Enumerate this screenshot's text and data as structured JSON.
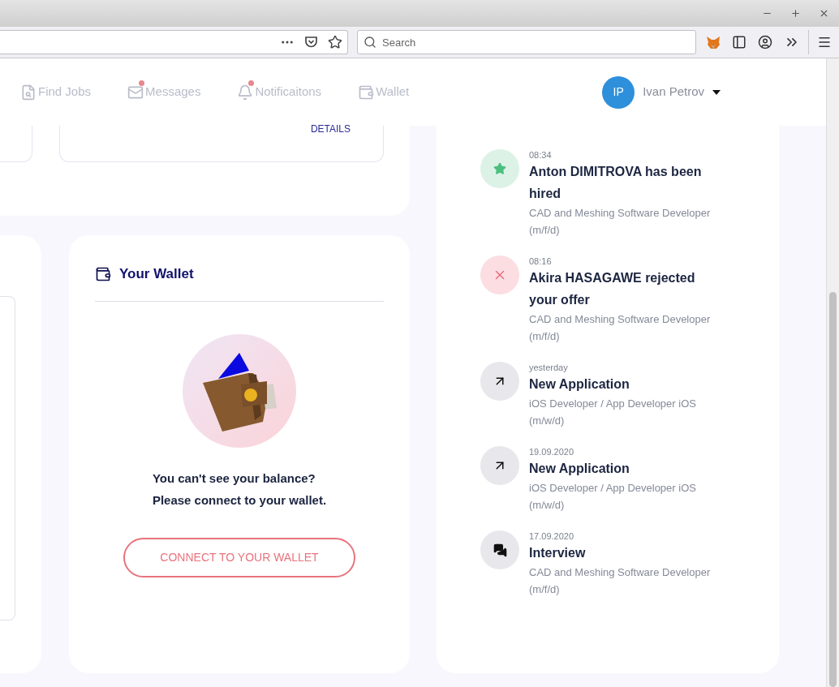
{
  "browser": {
    "search": {
      "placeholder": "Search"
    }
  },
  "nav": {
    "items": [
      {
        "kind": "jobs",
        "label": "Find Jobs",
        "badge": false
      },
      {
        "kind": "messages",
        "label": "Messages",
        "badge": true
      },
      {
        "kind": "notifications",
        "label": "Notificaitons",
        "badge": true
      },
      {
        "kind": "wallet",
        "label": "Wallet",
        "badge": false
      }
    ],
    "user": {
      "initials": "IP",
      "name": "Ivan Petrov"
    }
  },
  "offer_card": {
    "link": "DETAILS"
  },
  "wallet_card": {
    "title": "Your Wallet",
    "message": [
      "You can't see your balance?",
      "Please connect to your wallet."
    ],
    "button": "CONNECT TO YOUR WALLET"
  },
  "activity": [
    {
      "kind": "hired",
      "time": "08:34",
      "title": "Anton DIMITROVA has been hired",
      "subtitle": "CAD and Meshing Software Developer (m/f/d)"
    },
    {
      "kind": "rejected",
      "time": "08:16",
      "title": "Akira HASAGAWE rejected your offer",
      "subtitle": "CAD and Meshing Software Developer (m/f/d)"
    },
    {
      "kind": "application",
      "time": "yesterday",
      "title": "New Application",
      "subtitle": "iOS Developer / App Developer iOS (m/w/d)"
    },
    {
      "kind": "application",
      "time": "19.09.2020",
      "title": "New Application",
      "subtitle": "iOS Developer / App Developer iOS (m/w/d)"
    },
    {
      "kind": "interview",
      "time": "17.09.2020",
      "title": "Interview",
      "subtitle": "CAD and Meshing Software Developer (m/f/d)"
    }
  ]
}
